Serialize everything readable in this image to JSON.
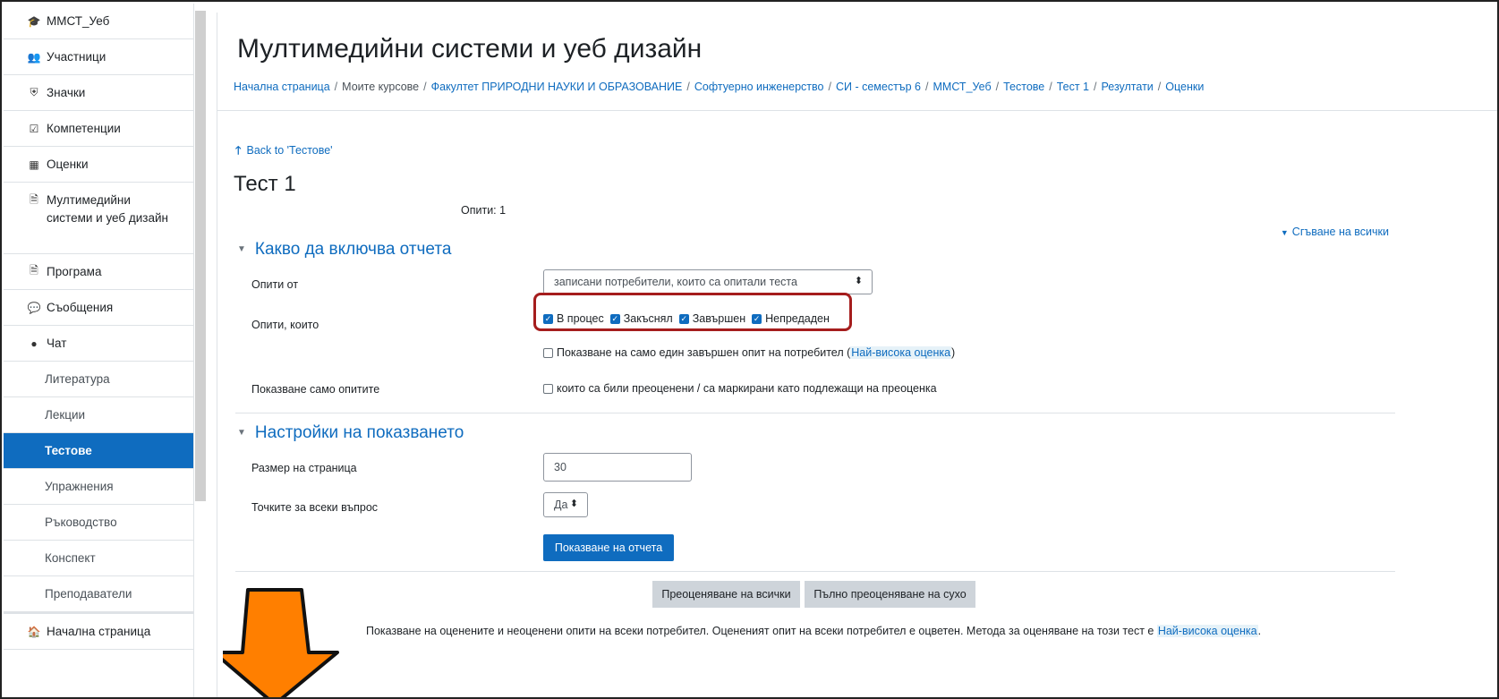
{
  "sidebar": {
    "items": [
      {
        "label": "ММСТ_Уеб",
        "icon": "graduation-cap-icon",
        "glyph": "🎓"
      },
      {
        "label": "Участници",
        "icon": "users-icon",
        "glyph": "👥"
      },
      {
        "label": "Значки",
        "icon": "shield-icon",
        "glyph": "⛨"
      },
      {
        "label": "Компетенции",
        "icon": "checkbox-icon",
        "glyph": "☑"
      },
      {
        "label": "Оценки",
        "icon": "table-icon",
        "glyph": "▦"
      },
      {
        "label": "Мултимедийни системи и уеб дизайн",
        "icon": "file-icon",
        "glyph": "🗎"
      },
      {
        "label": "Програма",
        "icon": "file-icon",
        "glyph": "🗎"
      },
      {
        "label": "Съобщения",
        "icon": "forum-icon",
        "glyph": "💬"
      },
      {
        "label": "Чат",
        "icon": "chat-icon",
        "glyph": "●"
      },
      {
        "label": "Литература"
      },
      {
        "label": "Лекции"
      },
      {
        "label": "Тестове",
        "active": true
      },
      {
        "label": "Упражнения"
      },
      {
        "label": "Ръководство"
      },
      {
        "label": "Конспект"
      },
      {
        "label": "Преподаватели"
      },
      {
        "label": "Начална страница",
        "icon": "home-icon",
        "glyph": "🏠"
      }
    ]
  },
  "header": {
    "title": "Мултимедийни системи и уеб дизайн",
    "breadcrumb": [
      {
        "label": "Начална страница",
        "link": true
      },
      {
        "label": "Моите курсове",
        "link": false
      },
      {
        "label": "Факултет ПРИРОДНИ НАУКИ И ОБРАЗОВАНИЕ",
        "link": true
      },
      {
        "label": "Софтуерно инженерство",
        "link": true
      },
      {
        "label": "СИ - семестър 6",
        "link": true
      },
      {
        "label": "ММСТ_Уеб",
        "link": true
      },
      {
        "label": "Тестове",
        "link": true
      },
      {
        "label": "Тест 1",
        "link": true
      },
      {
        "label": "Резултати",
        "link": true
      },
      {
        "label": "Оценки",
        "link": true
      }
    ],
    "breadcrumb_separator": "/"
  },
  "main": {
    "back_link": "Back to 'Тестове'",
    "quiz_title": "Тест 1",
    "attempts_text": "Опити: 1",
    "collapse_all": "Сгъване на всички",
    "section_report": {
      "heading": "Какво да включва отчета",
      "attempts_from_label": "Опити от",
      "attempts_from_value": "записани потребители, които са опитали теста",
      "attempts_that_label": "Опити, които",
      "states": [
        {
          "label": "В процес",
          "checked": true
        },
        {
          "label": "Закъснял",
          "checked": true
        },
        {
          "label": "Завършен",
          "checked": true
        },
        {
          "label": "Непредаден",
          "checked": true
        }
      ],
      "one_attempt_text": "Показване на само един завършен опит на потребител (",
      "one_attempt_highlight": "Най-висока оценка",
      "one_attempt_close": ")",
      "one_attempt_checked": false,
      "show_only_label": "Показване само опитите",
      "regraded_text": "които са били преоценени / са маркирани като подлежащи на преоценка",
      "regraded_checked": false
    },
    "section_display": {
      "heading": "Настройки на показването",
      "page_size_label": "Размер на страница",
      "page_size_value": "30",
      "marks_label": "Точките за всеки въпрос",
      "marks_value": "Да",
      "show_report_button": "Показване на отчета"
    },
    "regrade_all_button": "Преоценяване на всички",
    "dry_run_button": "Пълно преоценяване на сухо",
    "info_text": "Показване на оценените и неоценени опити на всеки потребител. Оцененият опит на всеки потребител е оцветен. Метода за оценяване на този тест е ",
    "info_highlight": "Най-висока оценка",
    "info_end": "."
  },
  "colors": {
    "accent": "#0f6cbf",
    "highlight_box": "#a51d1d",
    "arrow": "#ff7f00"
  }
}
